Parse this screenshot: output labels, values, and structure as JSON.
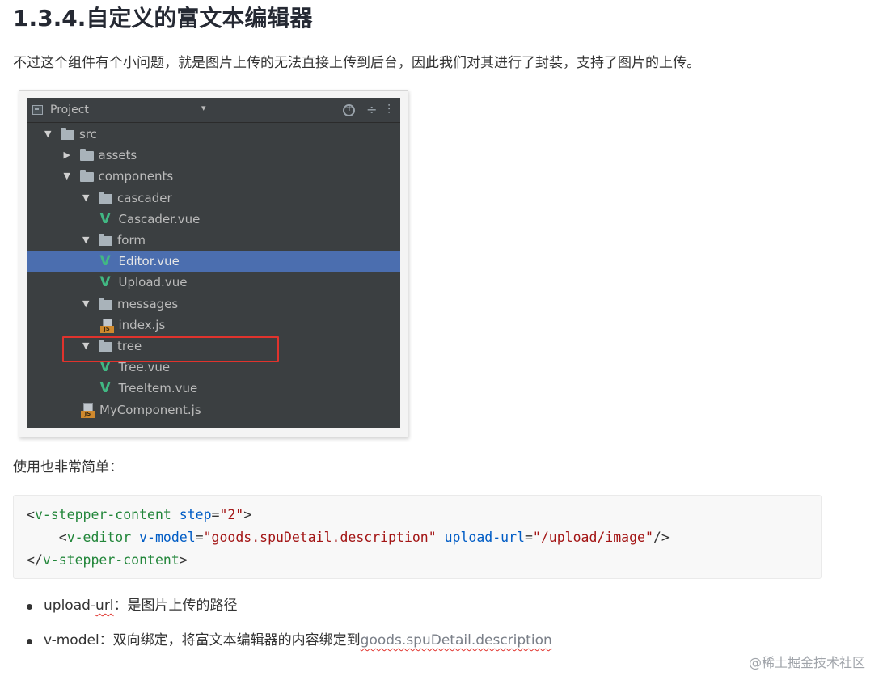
{
  "heading": "1.3.4.自定义的富文本编辑器",
  "intro": "不过这个组件有个小问题，就是图片上传的无法直接上传到后台，因此我们对其进行了封装，支持了图片的上传。",
  "ide": {
    "panel_title": "Project",
    "dropdown_glyph": "▾",
    "tool_collapse_glyph": "÷",
    "tool_more_glyph": "⫶",
    "tree": [
      {
        "label": "src",
        "type": "folder",
        "depth": 0,
        "expanded": true,
        "arrow": "▼"
      },
      {
        "label": "assets",
        "type": "folder",
        "depth": 1,
        "expanded": false,
        "arrow": "▶"
      },
      {
        "label": "components",
        "type": "folder",
        "depth": 1,
        "expanded": true,
        "arrow": "▼"
      },
      {
        "label": "cascader",
        "type": "folder",
        "depth": 2,
        "expanded": true,
        "arrow": "▼"
      },
      {
        "label": "Cascader.vue",
        "type": "vue",
        "depth": 3
      },
      {
        "label": "form",
        "type": "folder",
        "depth": 2,
        "expanded": true,
        "arrow": "▼"
      },
      {
        "label": "Editor.vue",
        "type": "vue",
        "depth": 3,
        "selected": true
      },
      {
        "label": "Upload.vue",
        "type": "vue",
        "depth": 3
      },
      {
        "label": "messages",
        "type": "folder",
        "depth": 2,
        "expanded": true,
        "arrow": "▼"
      },
      {
        "label": "index.js",
        "type": "js",
        "depth": 3
      },
      {
        "label": "tree",
        "type": "folder",
        "depth": 2,
        "expanded": true,
        "arrow": "▼"
      },
      {
        "label": "Tree.vue",
        "type": "vue",
        "depth": 3
      },
      {
        "label": "TreeItem.vue",
        "type": "vue",
        "depth": 3
      },
      {
        "label": "MyComponent.js",
        "type": "js",
        "depth": 2
      }
    ],
    "vue_glyph": "V",
    "js_badge": "JS",
    "colors": {
      "background": "#3b3f41",
      "selection": "#4b6eaf",
      "highlight_border": "#e0332d",
      "vue_green": "#41b883"
    }
  },
  "usage": "使用也非常简单：",
  "code": {
    "line1": {
      "open": "<",
      "tag": "v-stepper-content",
      "attr": " step",
      "eq": "=",
      "val": "\"2\"",
      "close": ">"
    },
    "line2": {
      "indent": "    ",
      "open": "<",
      "tag": "v-editor",
      "attr1": " v-model",
      "eq1": "=",
      "val1": "\"goods.spuDetail.description\"",
      "attr2": " upload-url",
      "eq2": "=",
      "val2": "\"/upload/image\"",
      "close": "/>"
    },
    "line3": {
      "open": "</",
      "tag": "v-stepper-content",
      "close": ">"
    }
  },
  "bullets": [
    {
      "pre": "upload-",
      "squiggle": "url",
      "post": "：是图片上传的路径"
    },
    {
      "pre": "v-model：双向绑定，将富文本编辑器的内容绑定到",
      "faded": "goods.spuDetail.description"
    }
  ],
  "watermark": "@稀土掘金技术社区"
}
